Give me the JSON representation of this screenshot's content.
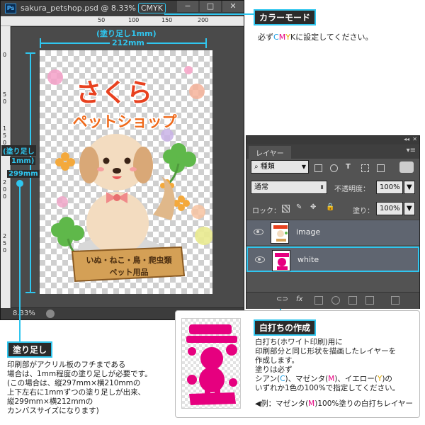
{
  "window": {
    "title": "sakura_petshop.psd @ 8.33%",
    "color_mode": "CMYK",
    "zoom": "8.33%",
    "minimize_label": "−",
    "maximize_label": "□",
    "close_label": "✕",
    "ruler_top": [
      "50",
      "100",
      "150",
      "200"
    ],
    "ruler_left": [
      "0",
      "5",
      "0",
      "1",
      "5",
      "0",
      "2",
      "0",
      "0",
      "2",
      "5",
      "0"
    ]
  },
  "artwork": {
    "title": "さくら",
    "subtitle": "ペットショップ",
    "sign_line1": "いぬ・ねこ・鳥・爬虫類",
    "sign_line2": "ペット用品"
  },
  "dimensions": {
    "bleed_top": "(塗り足し1mm)",
    "width": "212mm",
    "bleed_left_1": "(塗り足し",
    "bleed_left_2": "1mm)",
    "height": "299mm"
  },
  "callout_color": {
    "title": "カラーモード",
    "desc_pre": "必ず",
    "desc_c": "C",
    "desc_m": "M",
    "desc_y": "Y",
    "desc_k": "K",
    "desc_post": "に設定してください。"
  },
  "callout_bleed": {
    "title": "塗り足し",
    "lines": [
      "印刷部がアクリル板のフチまである",
      "場合は、1mm程度の塗り足しが必要です。",
      "(この場合は、縦297mm×横210mmの",
      "上下左右に1mmずつの塗り足しが出来、",
      "縦299mm×横212mmの",
      "カンバスサイズになります)"
    ]
  },
  "callout_white": {
    "title": "白打ちの作成",
    "lines": [
      "白打ち(ホワイト印刷)用に",
      "印刷部分と同じ形状を描画したレイヤーを",
      "作成します。",
      "塗りは必ず"
    ],
    "line5_pre": "シアン(",
    "line5_c": "C",
    "line5_mid1": ")、マゼンタ(",
    "line5_m": "M",
    "line5_mid2": ")、イエロー(",
    "line5_y": "Y",
    "line5_post": ")の",
    "line6": "いずれか1色の100%で指定してください。",
    "example_pre": "◀例：マゼンタ(",
    "example_m": "M",
    "example_post": ")100%塗りの白打ちレイヤー"
  },
  "layers_panel": {
    "tab": "レイヤー",
    "filter": "種類",
    "blend_mode": "通常",
    "opacity_label": "不透明度：",
    "opacity": "100%",
    "lock_label": "ロック：",
    "fill_label": "塗り：",
    "fill": "100%",
    "layers": [
      {
        "name": "image",
        "selected": false
      },
      {
        "name": "white",
        "selected": true
      }
    ]
  },
  "colors": {
    "accent": "#2fc6ef",
    "magenta": "#e6007f",
    "cyan": "#1a9fe6",
    "yellow": "#e0a800",
    "title_red": "#e8411f"
  }
}
